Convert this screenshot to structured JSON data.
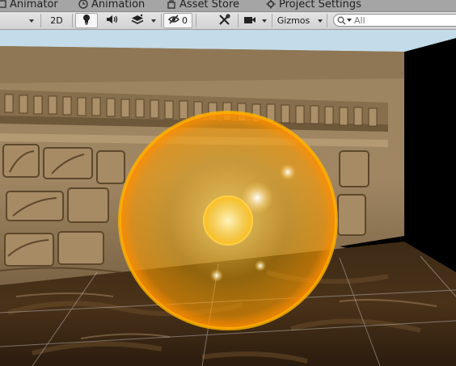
{
  "tabs": [
    {
      "label": "Animator",
      "icon": "animator-icon"
    },
    {
      "label": "Animation",
      "icon": "clock-icon"
    },
    {
      "label": "Asset Store",
      "icon": "store-bag-icon"
    },
    {
      "label": "Project Settings",
      "icon": "gear-icon"
    }
  ],
  "toolbar": {
    "mode_2d": "2D",
    "hidden_count": "0",
    "gizmos": "Gizmos",
    "search_placeholder": "All"
  },
  "colors": {
    "tab_strip": "#a5a5a5",
    "toolbar": "#d8d8d8",
    "sky": "#c4dbe9",
    "glow": "#ffb000"
  }
}
